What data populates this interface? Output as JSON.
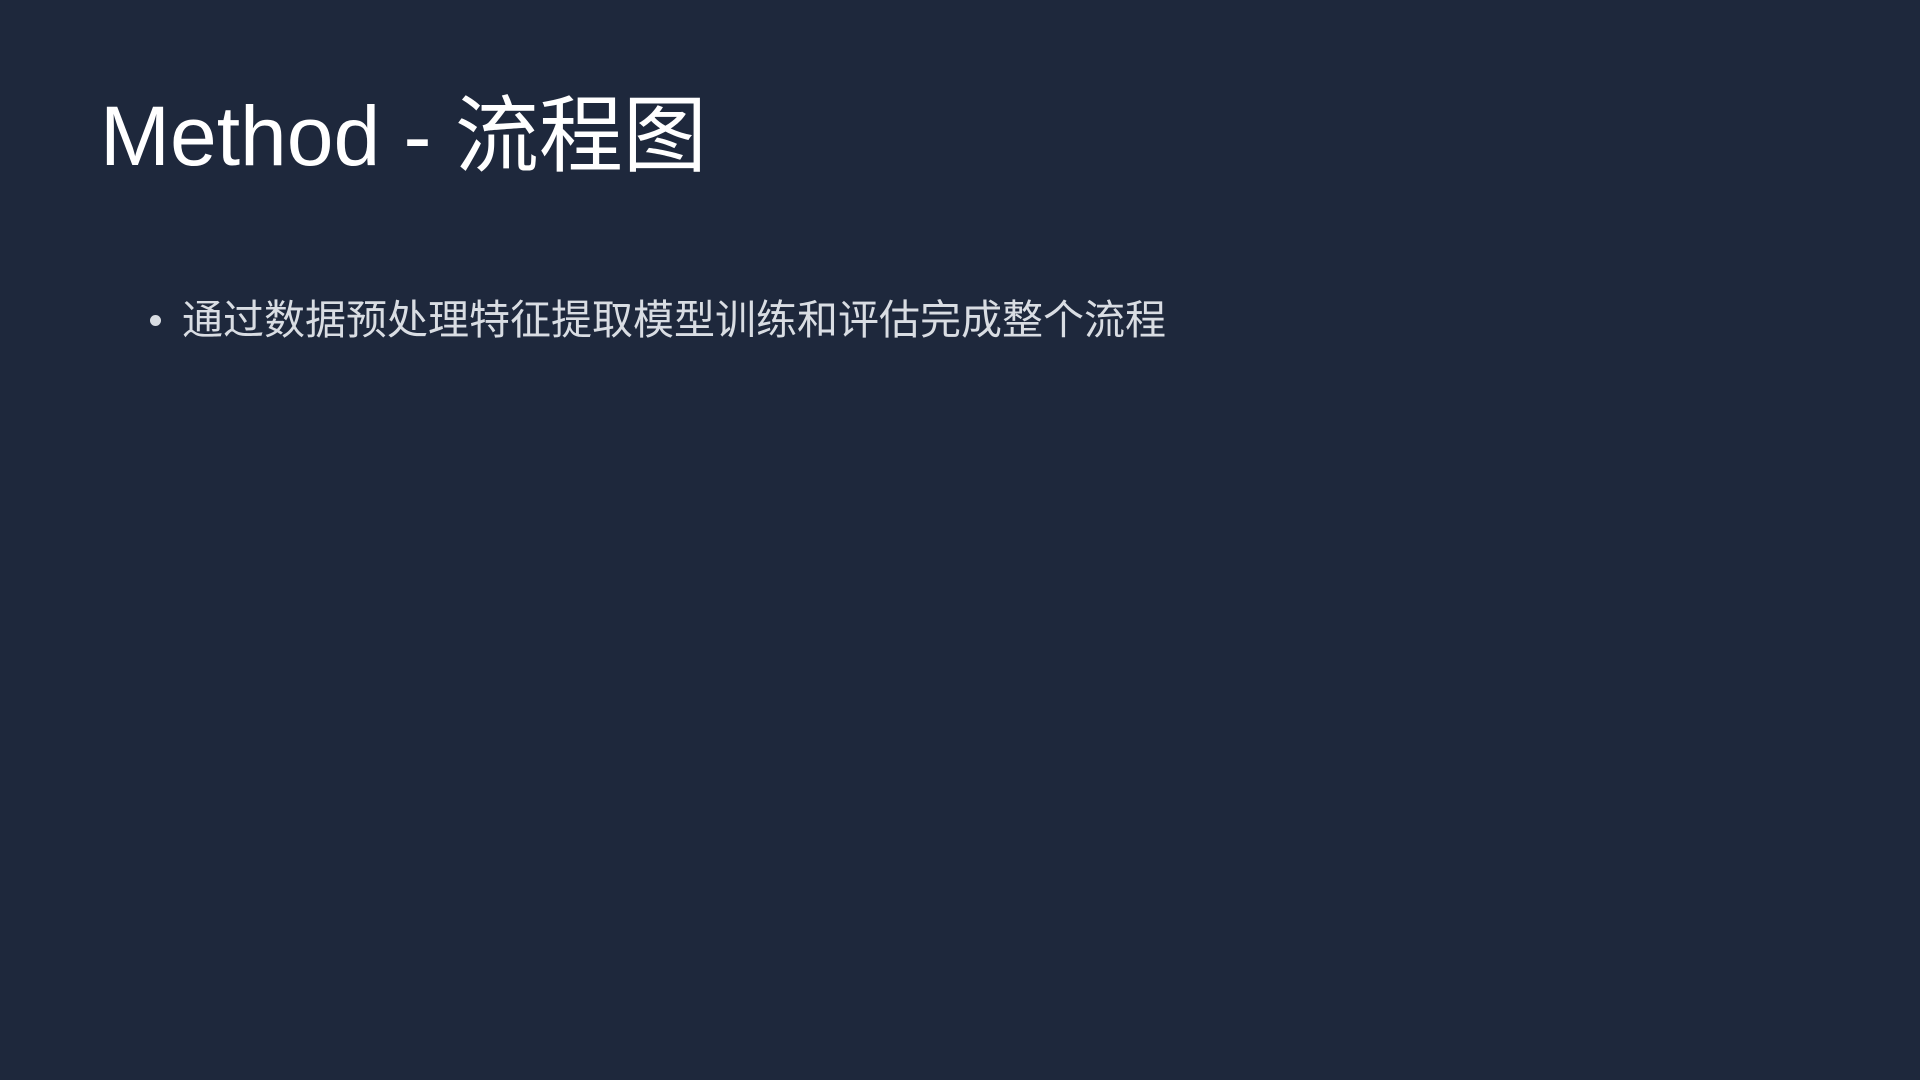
{
  "slide": {
    "title": "Method - 流程图",
    "bullets": [
      "通过数据预处理特征提取模型训练和评估完成整个流程"
    ],
    "colors": {
      "background": "#1e283c",
      "title": "#ffffff",
      "body_text": "#d9dde3"
    }
  }
}
